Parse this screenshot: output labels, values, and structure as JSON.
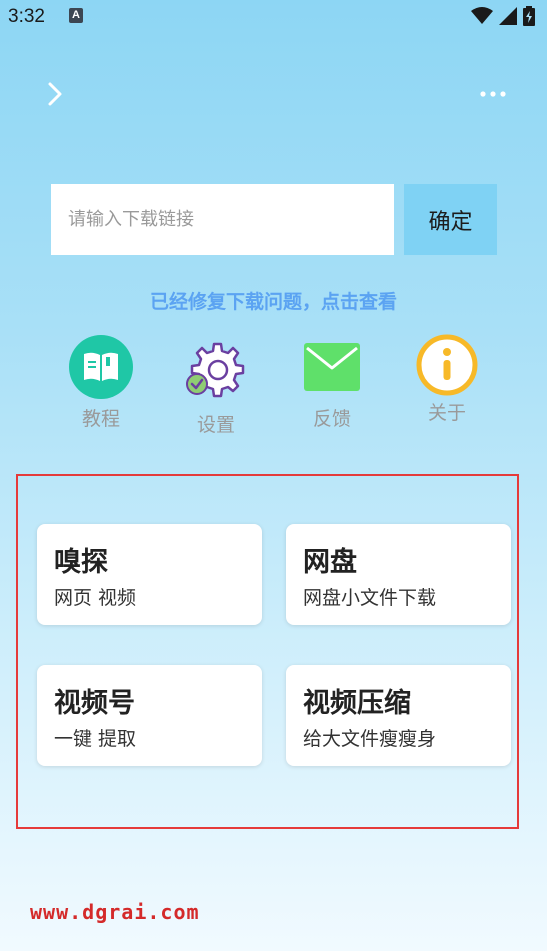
{
  "status_bar": {
    "time": "3:32",
    "notification_letter": "A"
  },
  "search": {
    "placeholder": "请输入下载链接",
    "value": "",
    "confirm_label": "确定"
  },
  "notice": "已经修复下载问题，点击查看",
  "quick_actions": [
    {
      "label": "教程",
      "icon": "book-icon",
      "color": "#1fc7a6"
    },
    {
      "label": "设置",
      "icon": "gear-icon",
      "color": "#6a3fa0"
    },
    {
      "label": "反馈",
      "icon": "mail-icon",
      "color": "#5fe06a"
    },
    {
      "label": "关于",
      "icon": "info-icon",
      "color": "#f7b928"
    }
  ],
  "features": [
    {
      "title": "嗅探",
      "subtitle": "网页 视频"
    },
    {
      "title": "网盘",
      "subtitle": "网盘小文件下载"
    },
    {
      "title": "视频号",
      "subtitle": "一键 提取"
    },
    {
      "title": "视频压缩",
      "subtitle": "给大文件瘦瘦身"
    }
  ],
  "watermark": "www.dgrai.com",
  "colors": {
    "accent": "#7fd2f4",
    "notice": "#5ba3f2",
    "highlight_border": "#e53a3a"
  }
}
